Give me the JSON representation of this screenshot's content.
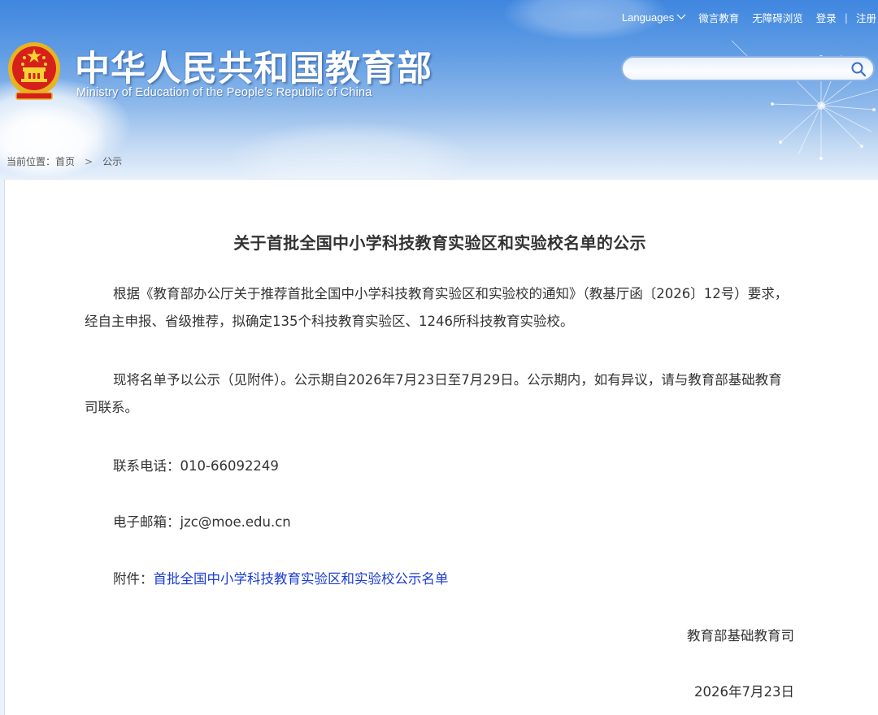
{
  "header": {
    "title_cn": "中华人民共和国教育部",
    "title_en": "Ministry of Education of the People's Republic of China",
    "nav": {
      "languages": "Languages",
      "weiyan": "微言教育",
      "accessible": "无障碍浏览",
      "login": "登录",
      "separator": "|",
      "register": "注册"
    },
    "search": {
      "value": "",
      "placeholder": ""
    }
  },
  "breadcrumb": {
    "prefix": "当前位置：",
    "home": "首页",
    "separator": ">",
    "current": "公示"
  },
  "article": {
    "title": "关于首批全国中小学科技教育实验区和实验校名单的公示",
    "paragraph1": "根据《教育部办公厅关于推荐首批全国中小学科技教育实验区和实验校的通知》（教基厅函〔2026〕12号）要求，经自主申报、省级推荐，拟确定135个科技教育实验区、1246所科技教育实验校。",
    "paragraph2": "现将名单予以公示（见附件）。公示期自2026年7月23日至7月29日。公示期内，如有异议，请与教育部基础教育司联系。",
    "phone_label": "联系电话：",
    "phone": "010-66092249",
    "email_label": "电子邮箱：",
    "email": "jzc@moe.edu.cn",
    "attachment_label": "附件：",
    "attachment_link": "首批全国中小学科技教育实验区和实验校公示名单",
    "signoff_org": "教育部基础教育司",
    "signoff_date": "2026年7月23日"
  },
  "colors": {
    "header_top": "#3f86df",
    "link": "#1a3bd6",
    "body_text": "#333333"
  },
  "icons": {
    "emblem": "national-emblem-icon",
    "search": "search-icon",
    "dropdown": "chevron-down-icon"
  }
}
